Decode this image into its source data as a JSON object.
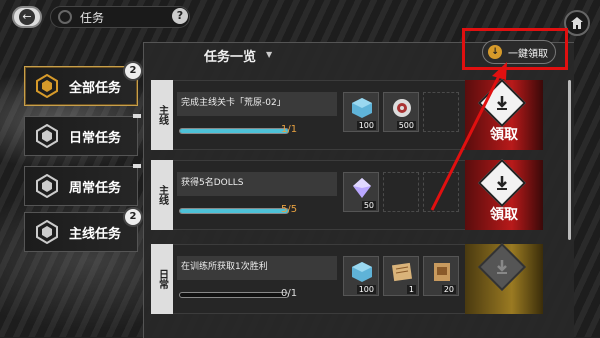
{
  "header": {
    "title": "任务"
  },
  "tabs": [
    {
      "label": "全部任务",
      "badge": "2",
      "active": true
    },
    {
      "label": "日常任务",
      "badge": "",
      "active": false
    },
    {
      "label": "周常任务",
      "badge": "",
      "active": false
    },
    {
      "label": "主线任务",
      "badge": "2",
      "active": false
    }
  ],
  "list": {
    "title": "任务一览",
    "claim_all_label": "一鍵領取"
  },
  "missions": [
    {
      "type_label": "主线",
      "description": "完成主线关卡「荒原-02」",
      "progress_text": "1/1",
      "progress_fraction": 1.0,
      "rewards": [
        {
          "icon": "data-cube-icon",
          "qty": "100"
        },
        {
          "icon": "gear-chip-icon",
          "qty": "500"
        }
      ],
      "claim_label": "領取",
      "style": "red"
    },
    {
      "type_label": "主线",
      "description": "获得5名DOLLS",
      "progress_text": "5/5",
      "progress_fraction": 1.0,
      "rewards": [
        {
          "icon": "crystal-icon",
          "qty": "50"
        }
      ],
      "claim_label": "領取",
      "style": "red"
    },
    {
      "type_label": "日常",
      "description": "在训练所获取1次胜利",
      "progress_text": "0/1",
      "progress_fraction": 0.0,
      "rewards": [
        {
          "icon": "data-cube-icon",
          "qty": "100"
        },
        {
          "icon": "map-scroll-icon",
          "qty": "1"
        },
        {
          "icon": "parchment-icon",
          "qty": "20"
        }
      ],
      "claim_label": "",
      "style": "gold"
    }
  ],
  "colors": {
    "accent_gold": "#d69a2a",
    "claim_red": "#b81a1a",
    "progress_cyan": "#4ec2d8",
    "highlight_red": "#e01010"
  }
}
